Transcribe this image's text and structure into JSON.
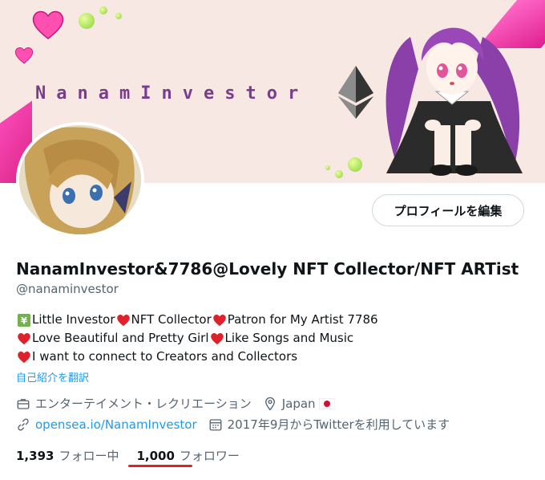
{
  "banner": {
    "text": "NanamInvestor",
    "colors": {
      "background": "#f8e8e4",
      "accent": "#e02090",
      "text": "#7a3d8c"
    }
  },
  "profile": {
    "edit_button_label": "プロフィールを編集",
    "display_name": "NanamInvestor&7786@Lovely NFT Collector/NFT ARTist",
    "handle": "@nanaminvestor",
    "bio": {
      "line1_a": "Little Investor",
      "line1_b": "NFT Collector",
      "line1_c": "Patron for My Artist 7786",
      "line2_a": "Love Beautiful and Pretty Girl",
      "line2_b": "Like Songs and Music",
      "line3_a": "I want to connect to Creators and Collectors"
    },
    "translate_label": "自己紹介を翻訳",
    "category": "エンターテイメント・レクリエーション",
    "location": "Japan",
    "website": "opensea.io/NanamInvestor",
    "joined": "2017年9月からTwitterを利用しています",
    "following_count": "1,393",
    "following_label": "フォロー中",
    "followers_count": "1,000",
    "followers_label": "フォロワー"
  },
  "icons": {
    "category": "briefcase-icon",
    "location": "map-pin-icon",
    "website": "link-icon",
    "joined": "calendar-icon",
    "heart": "red-heart-emoji",
    "yen": "yen-chart-emoji",
    "flag": "japan-flag-emoji"
  },
  "colors": {
    "link": "#1d9bf0",
    "muted": "#536471",
    "text": "#0f1419",
    "heart": "#e0202a",
    "underline": "#e0202a"
  }
}
